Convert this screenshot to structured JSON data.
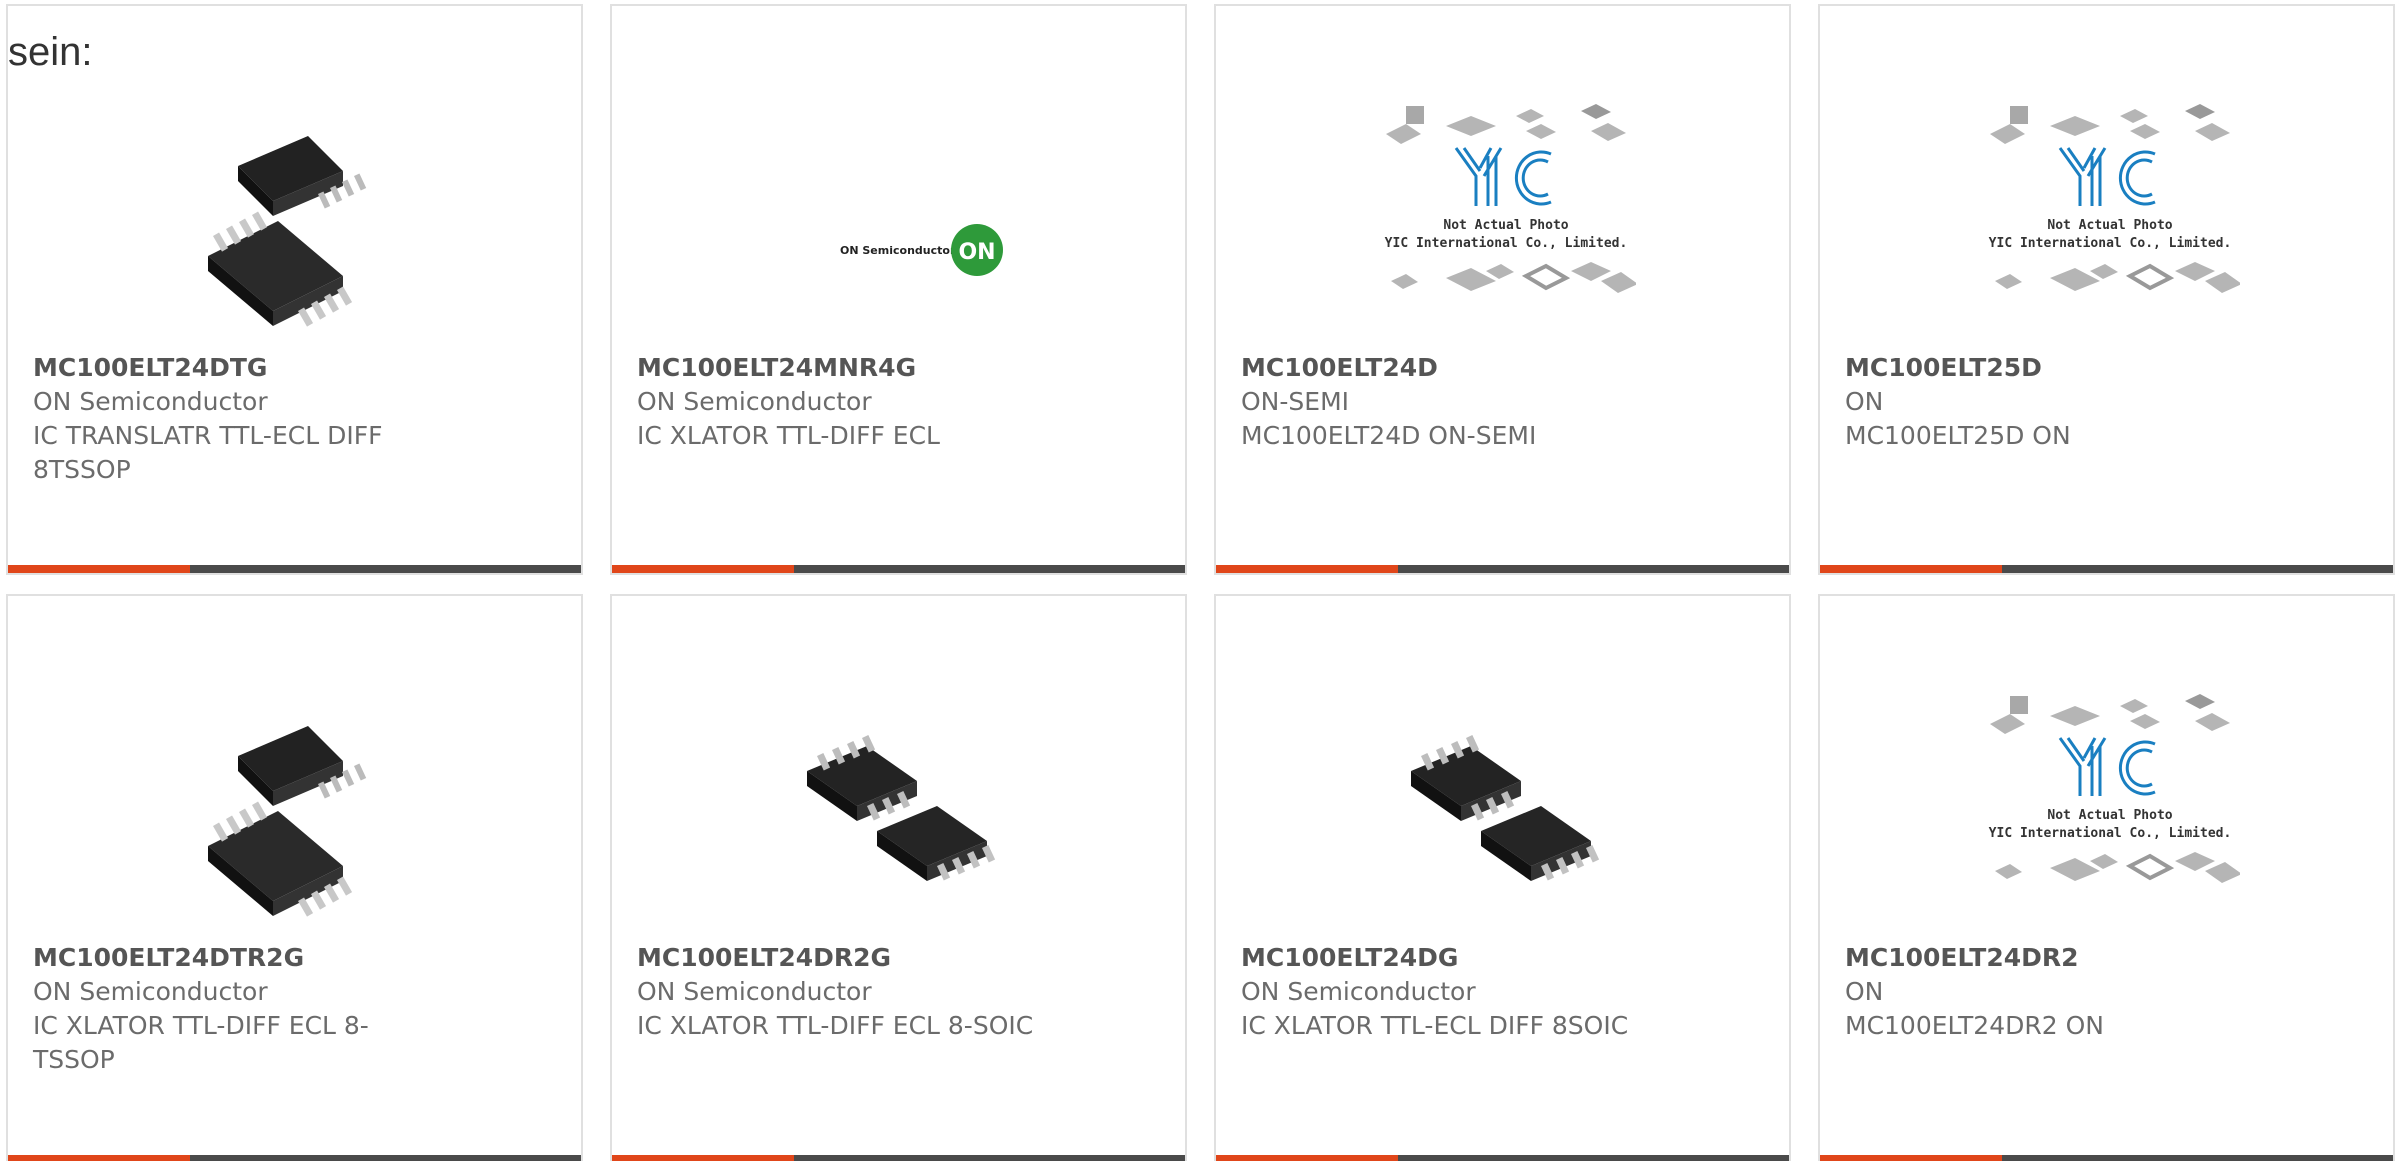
{
  "intro_text": "sein:",
  "products": [
    {
      "part": "MC100ELT24DTG",
      "brand": "ON Semiconductor",
      "desc": "IC TRANSLATR TTL-ECL DIFF 8TSSOP",
      "image": "chip-tssop-photo"
    },
    {
      "part": "MC100ELT24MNR4G",
      "brand": "ON Semiconductor",
      "desc": "IC XLATOR TTL-DIFF ECL",
      "image": "on-semiconductor-logo",
      "image_text": {
        "wordmark": "ON Semiconductor",
        "badge": "ON"
      }
    },
    {
      "part": "MC100ELT24D",
      "brand": "ON-SEMI",
      "desc": "MC100ELT24D ON-SEMI",
      "image": "yic-placeholder",
      "image_text": {
        "logo": "YIC",
        "line1": "Not Actual Photo",
        "line2": "YIC International Co., Limited."
      }
    },
    {
      "part": "MC100ELT25D",
      "brand": "ON",
      "desc": "MC100ELT25D ON",
      "image": "yic-placeholder",
      "image_text": {
        "logo": "YIC",
        "line1": "Not Actual Photo",
        "line2": "YIC International Co., Limited."
      }
    },
    {
      "part": "MC100ELT24DTR2G",
      "brand": "ON Semiconductor",
      "desc": "IC XLATOR TTL-DIFF ECL 8-TSSOP",
      "image": "chip-tssop-photo"
    },
    {
      "part": "MC100ELT24DR2G",
      "brand": "ON Semiconductor",
      "desc": "IC XLATOR TTL-DIFF ECL 8-SOIC",
      "image": "chip-soic-photo"
    },
    {
      "part": "MC100ELT24DG",
      "brand": "ON Semiconductor",
      "desc": "IC XLATOR TTL-ECL DIFF 8SOIC",
      "image": "chip-soic-photo"
    },
    {
      "part": "MC100ELT24DR2",
      "brand": "ON",
      "desc": "MC100ELT24DR2 ON",
      "image": "yic-placeholder",
      "image_text": {
        "logo": "YIC",
        "line1": "Not Actual Photo",
        "line2": "YIC International Co., Limited."
      }
    }
  ],
  "colors": {
    "accent_bar": "#e0461a",
    "base_bar": "#4a4a4a",
    "card_border": "#e0e0e0",
    "text": "#6b6b6b",
    "on_green": "#2e9a3a",
    "yic_blue": "#1a7fc1"
  }
}
